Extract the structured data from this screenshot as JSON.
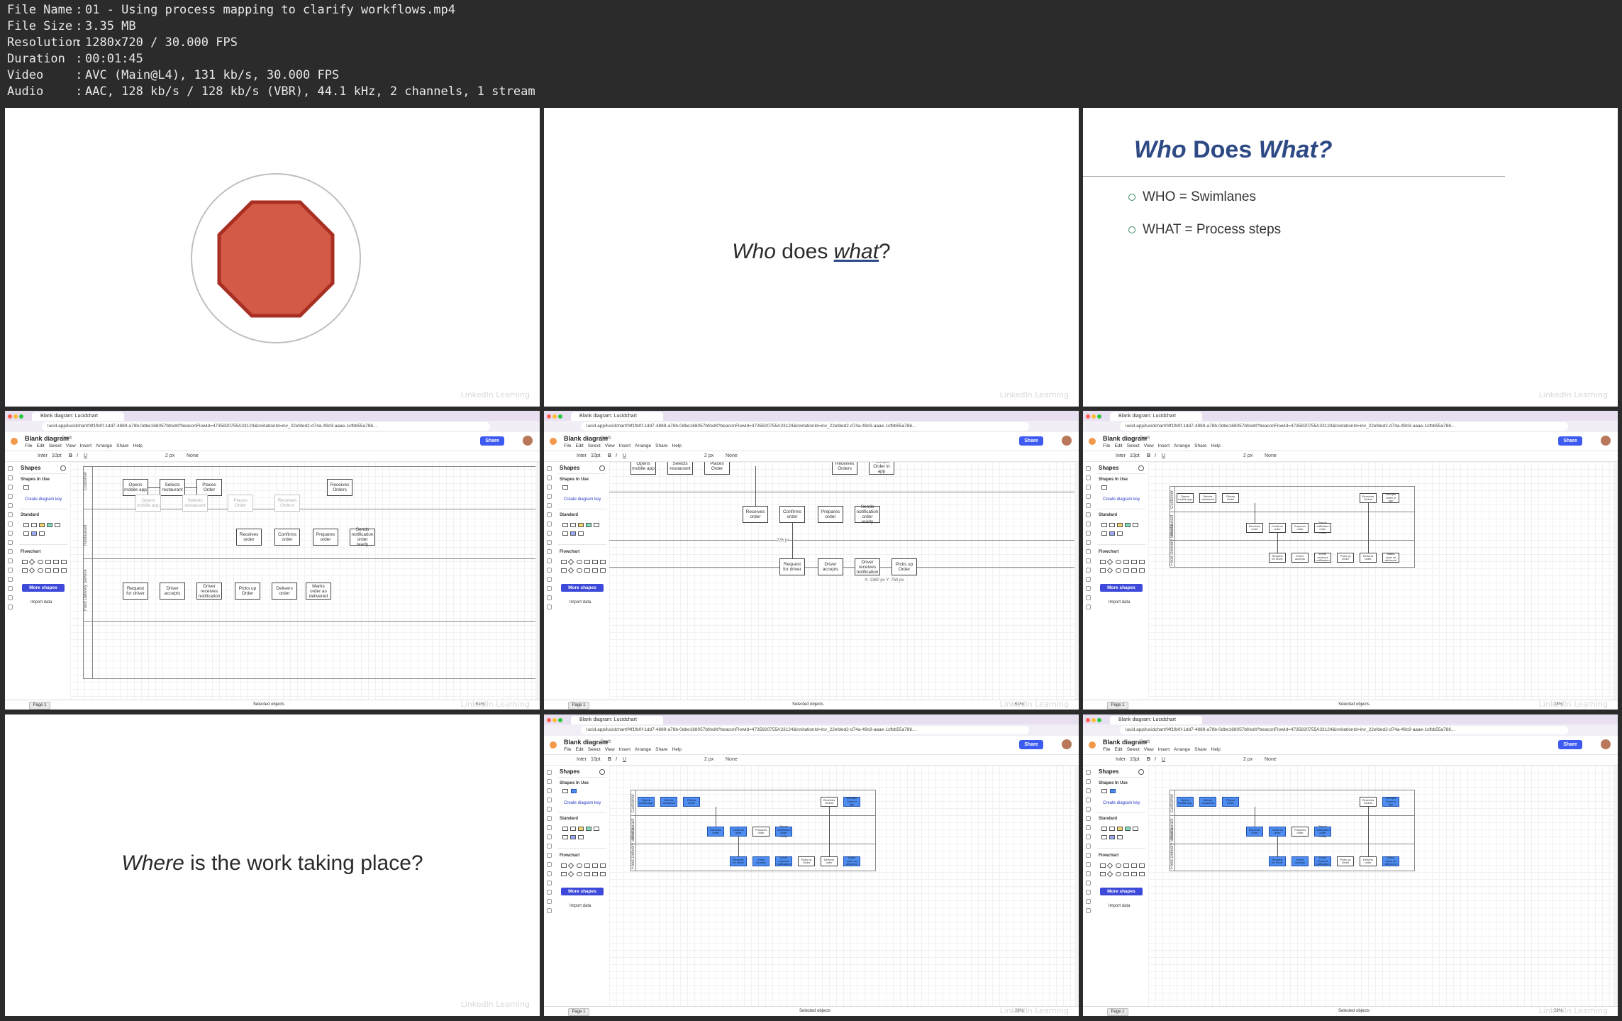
{
  "header": {
    "rows": [
      {
        "key": "File Name",
        "value": "01 - Using process mapping to clarify workflows.mp4"
      },
      {
        "key": "File Size",
        "value": "3.35 MB"
      },
      {
        "key": "Resolution",
        "value": "1280x720 / 30.000 FPS"
      },
      {
        "key": "Duration",
        "value": "00:01:45"
      },
      {
        "key": "Video",
        "value": "AVC (Main@L4), 131 kb/s, 30.000 FPS"
      },
      {
        "key": "Audio",
        "value": "AAC, 128 kb/s / 128 kb/s (VBR), 44.1 kHz, 2 channels, 1 stream"
      }
    ]
  },
  "watermark": "LinkedIn Learning",
  "slide2": {
    "w1": "Who",
    "w2": " does ",
    "w3": "what",
    "w4": "?"
  },
  "slide3": {
    "t1": "Who",
    "t2": " Does ",
    "t3": "What?",
    "b1": "WHO = Swimlanes",
    "b2": "WHAT = Process steps"
  },
  "slide7": {
    "w1": "Where",
    "w2": " is the work taking place?"
  },
  "app": {
    "tab_title": "Blank diagram: Lucidchart",
    "url": "lucid.app/lucidchart/f4f1fb0f-1dd7-4889-a78b-0dbe168057bf/edit?beaconFlowId=4735820755A33124&invitationId=inv_22efded2-d74a-49c9-aaae-1cfbb55a786...",
    "doc_title": "Blank diagram",
    "draft": "Draft",
    "menu": [
      "File",
      "Edit",
      "Select",
      "View",
      "Insert",
      "Arrange",
      "Share",
      "Help"
    ],
    "share": "Share",
    "font": "Inter",
    "font_size": "10pt",
    "line_width": "2 px",
    "none": "None",
    "shapes": "Shapes",
    "shapes_in_use": "Shapes In Use",
    "create_key": "Create diagram key",
    "standard": "Standard",
    "flowchart": "Flowchart",
    "more_shapes": "More shapes",
    "import_data": "Import data",
    "page": "Page 1",
    "selected": "Selected objects",
    "lanes": [
      "Customer",
      "Restaurant",
      "Food Delivery Service"
    ],
    "steps": {
      "s1": "Opens mobile app",
      "s2": "Selects restaurant",
      "s3": "Places Order",
      "s4": "Receives Orders",
      "s5": "Accepts Order in app",
      "s6": "Receives order",
      "s7": "Confirms order",
      "s8": "Prepares order",
      "s9": "Sends notification order ready",
      "s10": "Request for driver",
      "s11": "Driver accepts",
      "s12": "Driver receives notification",
      "s13": "Picks up Order",
      "s14": "Delivers order",
      "s15": "Marks order as delivered"
    },
    "zoom_a": "61%",
    "zoom_b": "38%",
    "dim_label": "226 px",
    "coord_label": "X: 1360 px  Y: 760 px"
  }
}
